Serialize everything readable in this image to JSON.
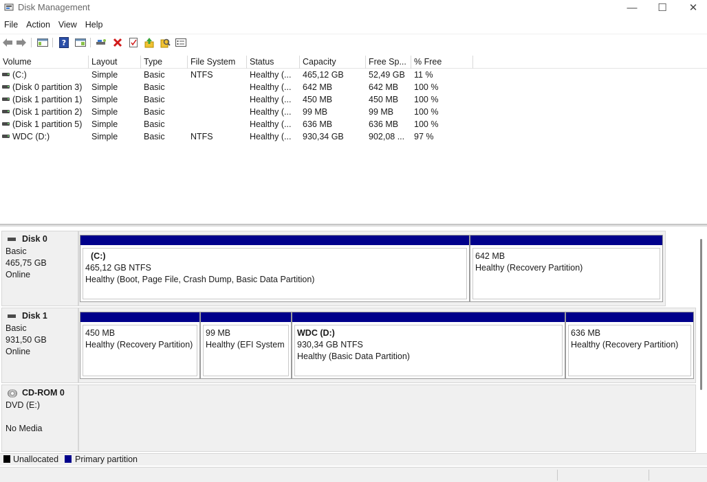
{
  "window": {
    "title": "Disk Management",
    "minimize_glyph": "—",
    "maximize_glyph": "☐",
    "close_glyph": "✕"
  },
  "menu": [
    "File",
    "Action",
    "View",
    "Help"
  ],
  "toolbar": {
    "icons": [
      "back-arrow-icon",
      "forward-arrow-icon",
      "console-tree-icon",
      "help-icon",
      "show-hide-icon",
      "connect-icon",
      "delete-icon",
      "properties-icon",
      "import-icon",
      "search-icon",
      "export-list-icon"
    ]
  },
  "volume_list": {
    "columns": [
      "Volume",
      "Layout",
      "Type",
      "File System",
      "Status",
      "Capacity",
      "Free Sp...",
      "% Free"
    ],
    "rows": [
      [
        "(C:)",
        "Simple",
        "Basic",
        "NTFS",
        "Healthy (...",
        "465,12 GB",
        "52,49 GB",
        "11 %"
      ],
      [
        "(Disk 0 partition 3)",
        "Simple",
        "Basic",
        "",
        "Healthy (...",
        "642 MB",
        "642 MB",
        "100 %"
      ],
      [
        "(Disk 1 partition 1)",
        "Simple",
        "Basic",
        "",
        "Healthy (...",
        "450 MB",
        "450 MB",
        "100 %"
      ],
      [
        "(Disk 1 partition 2)",
        "Simple",
        "Basic",
        "",
        "Healthy (...",
        "99 MB",
        "99 MB",
        "100 %"
      ],
      [
        "(Disk 1 partition 5)",
        "Simple",
        "Basic",
        "",
        "Healthy (...",
        "636 MB",
        "636 MB",
        "100 %"
      ],
      [
        "WDC (D:)",
        "Simple",
        "Basic",
        "NTFS",
        "Healthy (...",
        "930,34 GB",
        "902,08 ...",
        "97 %"
      ]
    ]
  },
  "disks": [
    {
      "name": "Disk 0",
      "type": "Basic",
      "size": "465,75 GB",
      "status": "Online",
      "partitions": [
        {
          "name": "(C:)",
          "size": "465,12 GB NTFS",
          "status": "Healthy (Boot, Page File, Crash Dump, Basic Data Partition)"
        },
        {
          "name": "",
          "size": "642 MB",
          "status": "Healthy (Recovery Partition)"
        }
      ]
    },
    {
      "name": "Disk 1",
      "type": "Basic",
      "size": "931,50 GB",
      "status": "Online",
      "partitions": [
        {
          "name": "",
          "size": "450 MB",
          "status": "Healthy (Recovery Partition)"
        },
        {
          "name": "",
          "size": "99 MB",
          "status": "Healthy (EFI System"
        },
        {
          "name": "WDC  (D:)",
          "size": "930,34 GB NTFS",
          "status": "Healthy (Basic Data Partition)"
        },
        {
          "name": "",
          "size": "636 MB",
          "status": "Healthy (Recovery Partition)"
        }
      ]
    },
    {
      "name": "CD-ROM 0",
      "type": "DVD (E:)",
      "status": "No Media"
    }
  ],
  "legend": {
    "unallocated": "Unallocated",
    "primary": "Primary partition",
    "unallocated_color": "#000000",
    "primary_color": "#00008b"
  }
}
